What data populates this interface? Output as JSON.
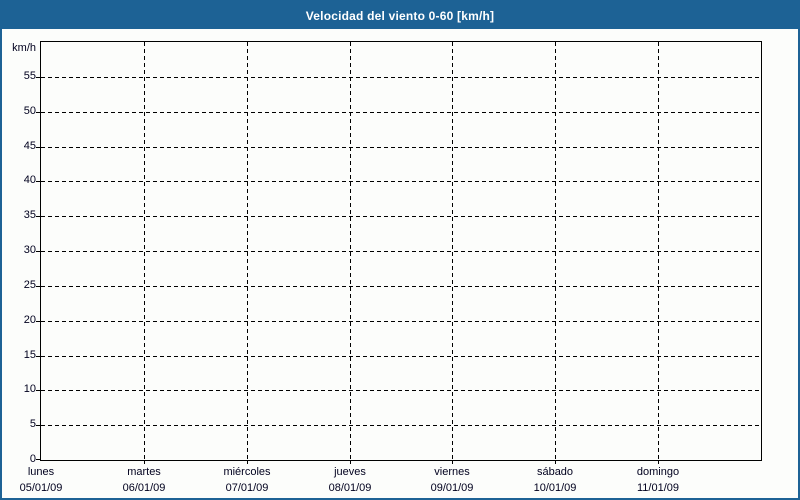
{
  "header": {
    "title": "Velocidad del viento 0-60 [km/h]"
  },
  "colors": {
    "header_bg": "#1d6295",
    "frame_border": "#1d6295",
    "header_text": "#ffffff",
    "background": "#fcfdfb",
    "plot_border": "#000000",
    "grid": "#000000",
    "label_text": "#00001e"
  },
  "chart_data": {
    "type": "line",
    "title": "Velocidad del viento 0-60 [km/h]",
    "ylabel": "km/h",
    "xlabel": "",
    "ylim": [
      0,
      60
    ],
    "yticks": [
      0,
      5,
      10,
      15,
      20,
      25,
      30,
      35,
      40,
      45,
      50,
      55
    ],
    "grid": "dashed",
    "legend": "none",
    "series": [],
    "x_categories": [
      {
        "day": "lunes",
        "date": "05/01/09"
      },
      {
        "day": "martes",
        "date": "06/01/09"
      },
      {
        "day": "miércoles",
        "date": "07/01/09"
      },
      {
        "day": "jueves",
        "date": "08/01/09"
      },
      {
        "day": "viernes",
        "date": "09/01/09"
      },
      {
        "day": "sábado",
        "date": "10/01/09"
      },
      {
        "day": "domingo",
        "date": "11/01/09"
      }
    ]
  }
}
